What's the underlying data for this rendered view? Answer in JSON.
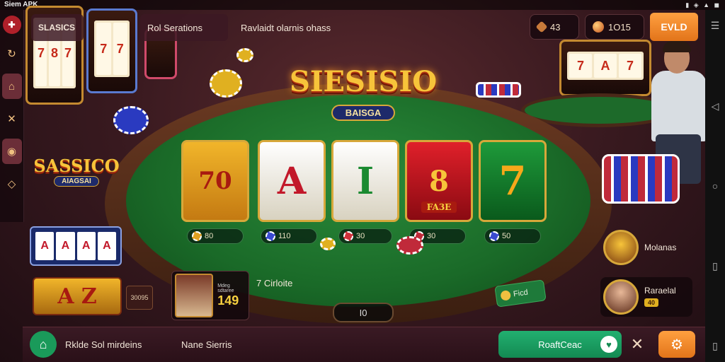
{
  "status_bar": {
    "app_title": "Siem APK",
    "system_icons": "▮ ◈ ▲ ◼"
  },
  "left_rail": {
    "items": [
      {
        "name": "logo",
        "glyph": "✚"
      },
      {
        "name": "history",
        "glyph": "↻"
      },
      {
        "name": "home",
        "glyph": "⌂"
      },
      {
        "name": "tools",
        "glyph": "✕"
      },
      {
        "name": "cookie",
        "glyph": "◉"
      },
      {
        "name": "chat",
        "glyph": "◇"
      }
    ]
  },
  "header": {
    "tab_slots": "SLASICS",
    "tab_sessions": "Rol Serations",
    "subtitle": "Ravlaidt olarnis ohass"
  },
  "hud": {
    "coins_value": "43",
    "gems_value": "1O15",
    "buy_label": "EVLD"
  },
  "main_logo": {
    "title": "SIESISIO",
    "badge": "BAISGA"
  },
  "left_logo": {
    "title": "SASSICO",
    "badge": "AIAGSAI"
  },
  "reels": [
    {
      "symbol": "70",
      "extra": ""
    },
    {
      "symbol": "A",
      "extra": ""
    },
    {
      "symbol": "I",
      "extra": ""
    },
    {
      "symbol": "8",
      "extra": "FA3E"
    },
    {
      "symbol": "7",
      "extra": ""
    }
  ],
  "bets": [
    "80",
    "110",
    "30",
    "30",
    "50"
  ],
  "bg_machines": {
    "m1": [
      "7",
      "8",
      "7"
    ],
    "m2": [
      "7",
      "7"
    ],
    "m4": [
      "7",
      "A",
      "7"
    ]
  },
  "mini_machine": [
    "A",
    "A",
    "A",
    "A"
  ],
  "mini_machine_2": "A Z",
  "small_plaque": "30095",
  "player": {
    "caption": "Mdeg sdtaree",
    "score": "149"
  },
  "round_label": "7 Cirloite",
  "center_slot": "I0",
  "next_tab": "Ficd",
  "opponents": [
    {
      "name": "Molanas",
      "badge": ""
    },
    {
      "name": "Raraelal",
      "badge": "40"
    }
  ],
  "bottom": {
    "text_1": "Rklde Sol mirdeins",
    "text_2": "Nane Sierris",
    "action_label": "RoaftCeac",
    "close_glyph": "✕",
    "settings_glyph": "⚙"
  },
  "colors": {
    "felt": "#1a6a28",
    "gold": "#f7c43a",
    "accent_orange": "#e2741a",
    "accent_green": "#138a52"
  }
}
